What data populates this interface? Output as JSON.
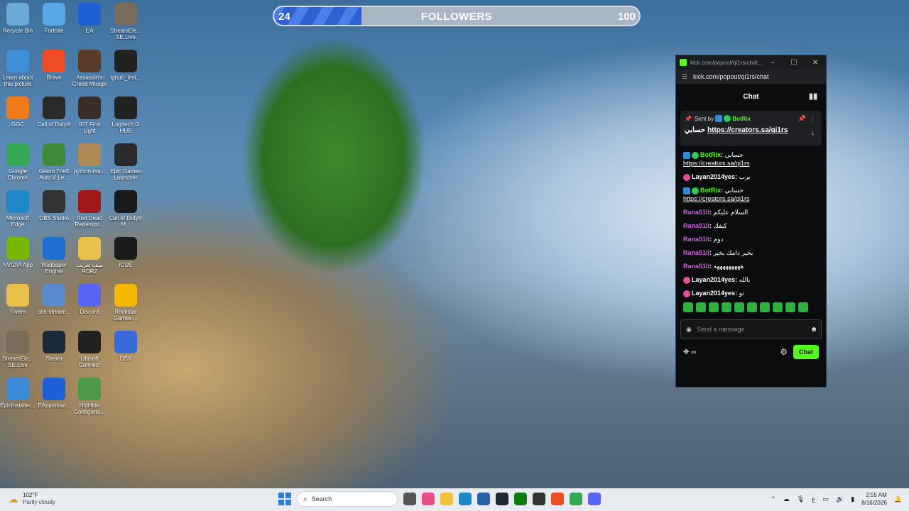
{
  "desktop": {
    "icons": [
      {
        "label": "Recycle Bin",
        "icon": "recycle-bin-icon",
        "color": "#6aa9d8"
      },
      {
        "label": "Fortnite",
        "icon": "fortnite-icon",
        "color": "#5aa7e8"
      },
      {
        "label": "EA",
        "icon": "ea-icon",
        "color": "#1e5fd6"
      },
      {
        "label": "StreamEle... SE.Live",
        "icon": "streamelements-icon",
        "color": "#7a6c5a"
      },
      {
        "label": "Learn about this picture",
        "icon": "learn-picture-icon",
        "color": "#3f8fd8"
      },
      {
        "label": "Brave",
        "icon": "brave-icon",
        "color": "#f04c23"
      },
      {
        "label": "Assassin's Creed Mirage",
        "icon": "assassins-creed-icon",
        "color": "#5a3b2a"
      },
      {
        "label": "lghub_inst...",
        "icon": "lghub-icon",
        "color": "#222222"
      },
      {
        "label": "GGC",
        "icon": "ggc-icon",
        "color": "#f07b1a"
      },
      {
        "label": "Call of Duty®",
        "icon": "call-of-duty-icon",
        "color": "#2a2a2a"
      },
      {
        "label": "007 First Light",
        "icon": "007-icon",
        "color": "#3b2e2a"
      },
      {
        "label": "Logitech G HUB",
        "icon": "logitech-ghub-icon",
        "color": "#222222"
      },
      {
        "label": "Google Chrome",
        "icon": "chrome-icon",
        "color": "#34a853"
      },
      {
        "label": "Grand Theft Auto V Le...",
        "icon": "gta-icon",
        "color": "#3f8a3a"
      },
      {
        "label": "python-ma...",
        "icon": "python-box-icon",
        "color": "#b08a55"
      },
      {
        "label": "Epic Games Launcher",
        "icon": "epic-games-icon",
        "color": "#2a2a2a"
      },
      {
        "label": "Microsoft Edge",
        "icon": "edge-icon",
        "color": "#1e88c8"
      },
      {
        "label": "OBS Studio",
        "icon": "obs-icon",
        "color": "#333333"
      },
      {
        "label": "Red Dead Redempti...",
        "icon": "red-dead-icon",
        "color": "#a01818"
      },
      {
        "label": "Call of Duty® M...",
        "icon": "cod-mw-icon",
        "color": "#1a1a1a"
      },
      {
        "label": "NVIDIA App",
        "icon": "nvidia-icon",
        "color": "#76b900"
      },
      {
        "label": "Wallpaper Engine",
        "icon": "wallpaper-engine-icon",
        "color": "#1f6fd0"
      },
      {
        "label": "ملف تعريب RDR2",
        "icon": "folder-icon",
        "color": "#e8c04a"
      },
      {
        "label": "iCUE",
        "icon": "icue-icon",
        "color": "#1a1a1a"
      },
      {
        "label": "Fivem",
        "icon": "fivem-folder-icon",
        "color": "#e8c04a"
      },
      {
        "label": "obs-stream...",
        "icon": "obs-stream-icon",
        "color": "#5a8ad0"
      },
      {
        "label": "Discord",
        "icon": "discord-icon",
        "color": "#5865f2"
      },
      {
        "label": "Rockstar Games ...",
        "icon": "rockstar-icon",
        "color": "#f5b800"
      },
      {
        "label": "StreamEle... SE.Live",
        "icon": "streamelements-icon",
        "color": "#7a6c5a"
      },
      {
        "label": "Steam",
        "icon": "steam-icon",
        "color": "#1b2838"
      },
      {
        "label": "Ubisoft Connect",
        "icon": "ubisoft-icon",
        "color": "#222222"
      },
      {
        "label": "DSX",
        "icon": "dsx-icon",
        "color": "#3a6ad8"
      },
      {
        "label": "EpicInstaller...",
        "icon": "epic-installer-icon",
        "color": "#3a8ad8"
      },
      {
        "label": "EAppInstal...",
        "icon": "ea-installer-icon",
        "color": "#1e5fd6"
      },
      {
        "label": "HidHide Configurat...",
        "icon": "hidhide-icon",
        "color": "#4a9a4a"
      }
    ]
  },
  "followers_widget": {
    "current": "24",
    "title": "FOLLOWERS",
    "goal": "100",
    "progress": 0.24
  },
  "popout": {
    "title": "kick.com/popout/qi1rs/chat...",
    "url": "kick.com/popout/qi1rs/chat",
    "chat_header": "Chat",
    "pinned": {
      "sent_by": "Sent by",
      "user": "BotRix",
      "text_prefix": "حسابي",
      "link": "https://creators.sa/qi1rs"
    },
    "messages": [
      {
        "user": "BotRix",
        "text": "حسابي",
        "link": "https://creators.sa/qi1rs",
        "style": "bot"
      },
      {
        "user": "Layan2014yes",
        "text": "برب",
        "link": "",
        "style": "layan"
      },
      {
        "user": "BotRix",
        "text": "حسابي",
        "link": "https://creators.sa/qi1rs",
        "style": "bot"
      },
      {
        "user": "Rana51li",
        "text": "السلام عليكم",
        "link": "",
        "style": "rana"
      },
      {
        "user": "Rana51li",
        "text": "كيفك",
        "link": "",
        "style": "rana"
      },
      {
        "user": "Rana51li",
        "text": "دوم",
        "link": "",
        "style": "rana"
      },
      {
        "user": "Rana51li",
        "text": "بخير دامك بخير",
        "link": "",
        "style": "rana"
      },
      {
        "user": "Rana51li",
        "text": "هههههههههه",
        "link": "",
        "style": "rana"
      },
      {
        "user": "Layan2014yes",
        "text": "بالله",
        "link": "",
        "style": "layan"
      },
      {
        "user": "Layan2014yes",
        "text": "تو",
        "link": "",
        "style": "layan"
      }
    ],
    "input_placeholder": "Send a message",
    "send_label": "Chat",
    "accent": "#53fc18"
  },
  "taskbar": {
    "weather_temp": "102°F",
    "weather_desc": "Partly cloudy",
    "search_placeholder": "Search",
    "time": "2:55 AM",
    "date": "8/16/2026",
    "lang": "ع"
  }
}
